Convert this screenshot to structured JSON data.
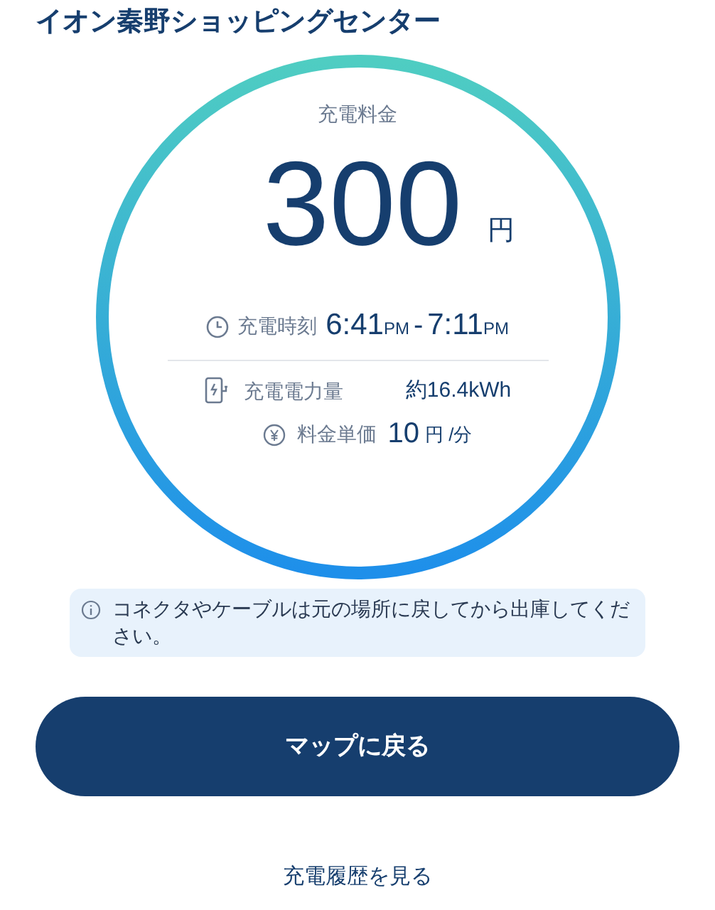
{
  "title": "イオン秦野ショッピングセンター",
  "fee": {
    "label": "充電料金",
    "amount": "300",
    "unit": "円"
  },
  "time": {
    "label": "充電時刻",
    "start": "6:41",
    "start_suffix": "PM",
    "separator": "-",
    "end": "7:11",
    "end_suffix": "PM"
  },
  "energy": {
    "label": "充電電力量",
    "value": "約16.4kWh"
  },
  "price": {
    "label": "料金単価",
    "value": "10",
    "unit": "円 /分"
  },
  "notice": {
    "text": "コネクタやケーブルは元の場所に戻してから出庫してください。"
  },
  "primary_button": {
    "label": "マップに戻る"
  },
  "history_link": {
    "label": "充電履歴を見る"
  }
}
